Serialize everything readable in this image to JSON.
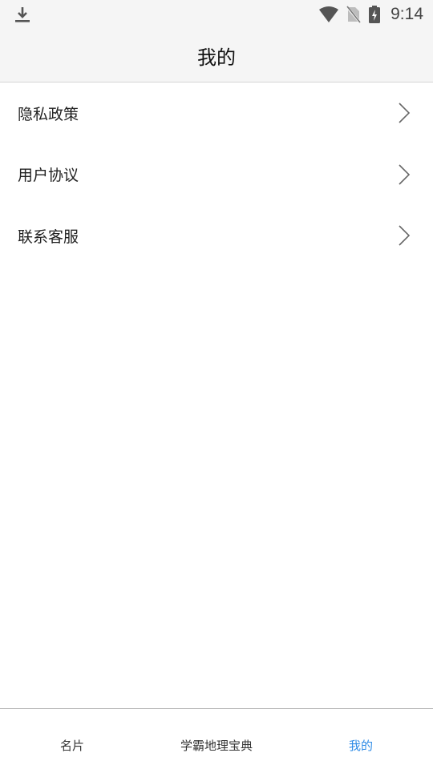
{
  "status_bar": {
    "time": "9:14",
    "icons": [
      "download-icon",
      "wifi-icon",
      "no-sim-icon",
      "battery-charging-icon"
    ]
  },
  "header": {
    "title": "我的"
  },
  "menu": {
    "items": [
      {
        "label": "隐私政策",
        "icon": "chevron-right-icon"
      },
      {
        "label": "用户协议",
        "icon": "chevron-right-icon"
      },
      {
        "label": "联系客服",
        "icon": "chevron-right-icon"
      }
    ]
  },
  "bottom_nav": {
    "tabs": [
      {
        "label": "名片",
        "active": false
      },
      {
        "label": "学霸地理宝典",
        "active": false
      },
      {
        "label": "我的",
        "active": true
      }
    ],
    "active_color": "#2e8be6"
  }
}
